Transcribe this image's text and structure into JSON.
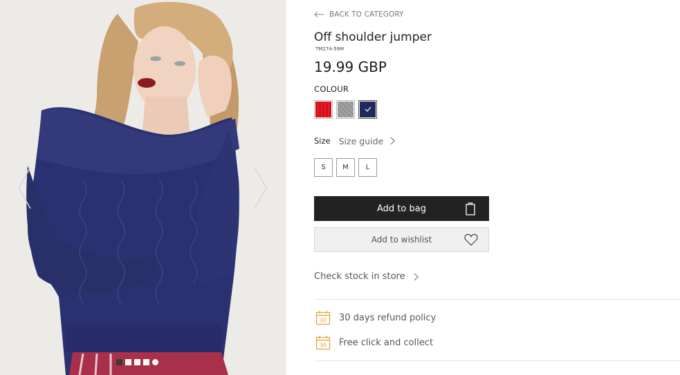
{
  "gallery": {
    "dot_count": 5,
    "active_dot": 1
  },
  "product": {
    "back_label": "BACK TO CATEGORY",
    "title": "Off shoulder jumper",
    "sku": "TM274-59M",
    "price": "19.99 GBP",
    "colour_label": "COLOUR",
    "colours": [
      {
        "name": "red",
        "hex": "#d0111b"
      },
      {
        "name": "grey",
        "hex": "#c4c4c4"
      },
      {
        "name": "navy",
        "hex": "#1f2a5a",
        "selected": true
      }
    ],
    "size_label": "Size",
    "size_guide_label": "Size guide",
    "sizes": [
      "S",
      "M",
      "L"
    ],
    "add_to_bag_label": "Add to bag",
    "add_to_wishlist_label": "Add to wishlist",
    "check_stock_label": "Check stock in store",
    "perks": [
      {
        "icon": "calendar-30-icon",
        "label": "30 days refund policy",
        "badge": "30"
      },
      {
        "icon": "calendar-30-icon",
        "label": "Free click and collect",
        "badge": "30"
      }
    ]
  },
  "colors": {
    "accent_dark": "#222222",
    "perk_icon": "#e2a43a",
    "sweater_navy": "#2a3170"
  }
}
